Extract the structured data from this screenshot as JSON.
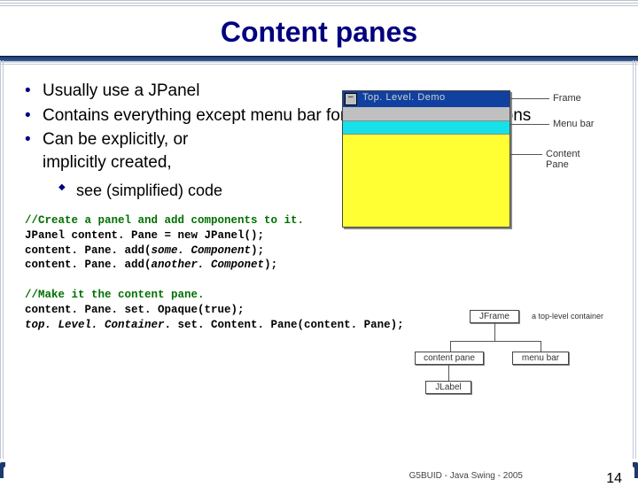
{
  "title": "Content panes",
  "bullets": {
    "b1": "Usually use a JPanel",
    "b2": "Contains everything except menu bar for most Swing applications",
    "b3a": "Can be explicitly, or",
    "b3b": "implicitly created,",
    "sub1": "see (simplified) code"
  },
  "code": {
    "c1": "//Create a panel and add components to it.",
    "l2a": "JPanel content. Pane = new JPanel();",
    "l3a": "content. Pane. add(",
    "l3b": "some. Component",
    "l3c": ");",
    "l4a": "content. Pane. add(",
    "l4b": "another. Componet",
    "l4c": ");",
    "c2": "//Make it the content pane.",
    "l6": "content. Pane. set. Opaque(true);",
    "l7a": "top. Level. Container",
    "l7b": ". set. Content. Pane(content. Pane);"
  },
  "diag1": {
    "caption": "Top. Level. Demo",
    "frame": "Frame",
    "menubar": "Menu bar",
    "contentpane": "Content Pane"
  },
  "diag2": {
    "jframe": "JFrame",
    "toplevel": "a top-level container",
    "contentpane": "content pane",
    "menubar": "menu bar",
    "jlabel": "JLabel"
  },
  "footer": {
    "caption": "G5BUID - Java Swing - 2005",
    "page": "14"
  }
}
